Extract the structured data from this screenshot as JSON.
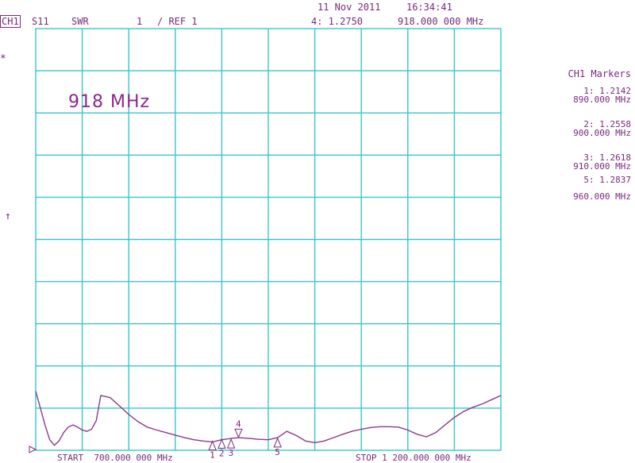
{
  "header": {
    "date": "11 Nov 2011",
    "time": "16:34:41",
    "channel": "CH1",
    "param": "S11",
    "format": "SWR",
    "scale": "1",
    "ref": "/ REF 1",
    "active_marker": "4: 1.2750",
    "active_marker_freq": "918.000 000 MHz"
  },
  "left_symbols": {
    "star": "*",
    "ref_arrow": "↑"
  },
  "annotation": "918 MHz",
  "markers_panel": {
    "title": "CH1 Markers",
    "entries": [
      {
        "line1": "1: 1.2142",
        "line2": "890.000 MHz"
      },
      {
        "line1": "2: 1.2558",
        "line2": "900.000 MHz"
      },
      {
        "line1": "3: 1.2618",
        "line2": "910.000 MHz"
      },
      {
        "line1": "5: 1.2837",
        "line2": "960.000 MHz"
      }
    ]
  },
  "footer": {
    "start": "START  700.000 000 MHz",
    "stop": "STOP 1 200.000 000 MHz"
  },
  "colors": {
    "grid": "#36c6d0",
    "trace": "#8a3a8a",
    "text": "#7a2a7a"
  },
  "chart_data": {
    "type": "line",
    "title": "",
    "xlabel": "",
    "ylabel": "",
    "xlim": [
      700,
      1200
    ],
    "ylim": [
      1,
      11
    ],
    "grid": true,
    "series": [
      {
        "x": [
          700,
          705,
          710,
          715,
          720,
          725,
          730,
          735,
          740,
          745,
          750,
          755,
          760,
          765,
          770,
          780,
          790,
          800,
          810,
          820,
          830,
          840,
          850,
          860,
          870,
          880,
          890,
          900,
          910,
          918,
          930,
          940,
          950,
          960,
          970,
          980,
          990,
          1000,
          1010,
          1020,
          1030,
          1040,
          1050,
          1060,
          1070,
          1080,
          1090,
          1100,
          1110,
          1120,
          1130,
          1140,
          1150,
          1160,
          1170,
          1180,
          1190,
          1200
        ],
        "y": [
          2.4,
          2.0,
          1.6,
          1.25,
          1.12,
          1.22,
          1.42,
          1.55,
          1.6,
          1.55,
          1.48,
          1.45,
          1.5,
          1.7,
          2.3,
          2.25,
          2.05,
          1.85,
          1.68,
          1.55,
          1.48,
          1.42,
          1.36,
          1.3,
          1.25,
          1.22,
          1.2,
          1.25,
          1.28,
          1.3,
          1.28,
          1.26,
          1.25,
          1.3,
          1.45,
          1.35,
          1.22,
          1.18,
          1.22,
          1.3,
          1.38,
          1.45,
          1.5,
          1.54,
          1.56,
          1.56,
          1.55,
          1.48,
          1.38,
          1.32,
          1.42,
          1.6,
          1.78,
          1.92,
          2.02,
          2.1,
          2.2,
          2.3
        ]
      }
    ],
    "markers": [
      {
        "label": "1",
        "x": 890,
        "y": 1.2142,
        "dir": "up"
      },
      {
        "label": "2",
        "x": 900,
        "y": 1.2558,
        "dir": "up"
      },
      {
        "label": "3",
        "x": 910,
        "y": 1.2618,
        "dir": "up"
      },
      {
        "label": "4",
        "x": 918,
        "y": 1.275,
        "dir": "down"
      },
      {
        "label": "5",
        "x": 960,
        "y": 1.2837,
        "dir": "up"
      }
    ]
  }
}
